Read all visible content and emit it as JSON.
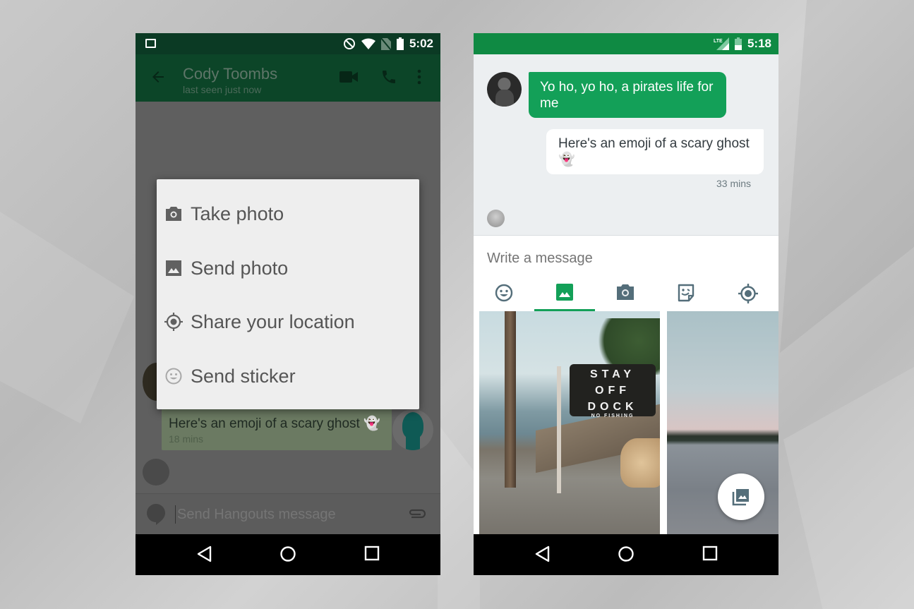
{
  "left_phone": {
    "status_bar": {
      "time": "5:02",
      "icons": [
        "gallery-notification-icon",
        "do-not-disturb-icon",
        "wifi-icon",
        "no-sim-icon",
        "battery-icon"
      ]
    },
    "toolbar": {
      "contact_name": "Cody Toombs",
      "subtitle": "last seen just now",
      "actions": [
        "back-arrow-icon",
        "video-call-icon",
        "phone-call-icon",
        "more-vert-icon"
      ]
    },
    "attach_menu": {
      "items": [
        {
          "label": "Take photo",
          "icon": "camera-icon"
        },
        {
          "label": "Send photo",
          "icon": "image-icon"
        },
        {
          "label": "Share your location",
          "icon": "location-target-icon"
        },
        {
          "label": "Send sticker",
          "icon": "smiley-icon"
        }
      ]
    },
    "messages": [
      {
        "text": "Here's an emoji of a scary ghost 👻",
        "time": "18 mins",
        "from": "me"
      }
    ],
    "composer": {
      "placeholder": "Send Hangouts message",
      "value": ""
    },
    "nav_bar": [
      "back",
      "home",
      "recents"
    ]
  },
  "right_phone": {
    "status_bar": {
      "time": "5:18",
      "network": "LTE",
      "icons": [
        "lte-signal-icon",
        "battery-icon"
      ]
    },
    "messages": [
      {
        "text": "Yo ho, yo ho, a pirates life for me",
        "from": "contact"
      },
      {
        "text": "Here's an emoji of a scary ghost 👻",
        "from": "me",
        "time": "33 mins"
      }
    ],
    "composer": {
      "placeholder": "Write a message",
      "value": ""
    },
    "attach_tabs": [
      {
        "name": "emoji",
        "active": false
      },
      {
        "name": "gallery",
        "active": true
      },
      {
        "name": "camera",
        "active": false
      },
      {
        "name": "sticker",
        "active": false
      },
      {
        "name": "location",
        "active": false
      }
    ],
    "gallery": {
      "photos": [
        {
          "description": "Dock with sign",
          "sign_lines": [
            "STAY",
            "OFF",
            "DOCK"
          ],
          "sign_small": "NO FISHING"
        },
        {
          "description": "Lake at sunset"
        }
      ],
      "fab_icon": "photo-library-icon"
    },
    "nav_bar": [
      "back",
      "home",
      "recents"
    ]
  },
  "colors": {
    "hangouts_green": "#13a058",
    "status_green": "#0f8a43",
    "dim_toolbar": "#0c4528",
    "chat_bg": "#eceff1",
    "menu_bg": "#eeeeee"
  }
}
